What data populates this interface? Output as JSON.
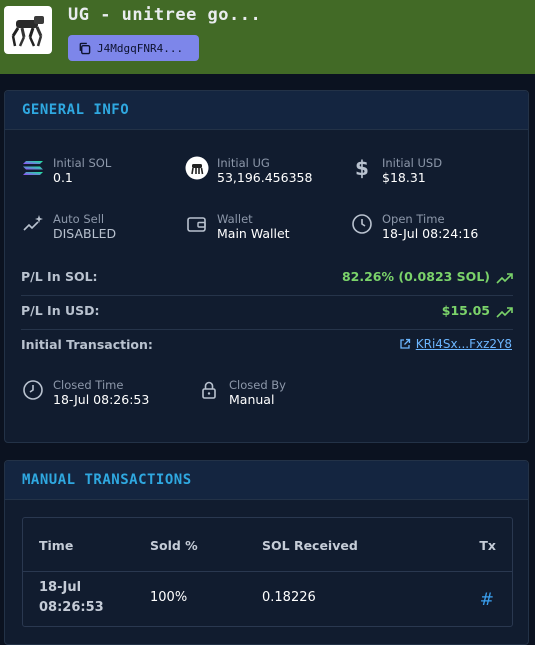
{
  "header": {
    "title": "UG - unitree go...",
    "mint_short": "J4MdgqFNR4..."
  },
  "general": {
    "title": "GENERAL INFO",
    "items": [
      {
        "label": "Initial SOL",
        "value": "0.1"
      },
      {
        "label": "Initial UG",
        "value": "53,196.456358"
      },
      {
        "label": "Initial USD",
        "value": "$18.31"
      },
      {
        "label": "Auto Sell",
        "value": "DISABLED"
      },
      {
        "label": "Wallet",
        "value": "Main Wallet"
      },
      {
        "label": "Open Time",
        "value": "18-Jul 08:24:16"
      }
    ],
    "pl_sol_label": "P/L In SOL:",
    "pl_sol_value": "82.26% (0.0823 SOL)",
    "pl_usd_label": "P/L In USD:",
    "pl_usd_value": "$15.05",
    "init_tx_label": "Initial Transaction:",
    "init_tx_value": "KRi4Sx...Fxz2Y8",
    "closed_time_label": "Closed Time",
    "closed_time_value": "18-Jul 08:26:53",
    "closed_by_label": "Closed By",
    "closed_by_value": "Manual",
    "positive_color": "#7bd36a"
  },
  "manual": {
    "title": "MANUAL TRANSACTIONS",
    "columns": [
      "Time",
      "Sold %",
      "SOL Received",
      "Tx"
    ],
    "rows": [
      {
        "time_date": "18-Jul",
        "time_clock": "08:26:53",
        "sold": "100%",
        "received": "0.18226",
        "tx": "#"
      }
    ]
  },
  "colors": {
    "header_bg": "#426a26",
    "accent": "#2fa8e0",
    "chip": "#7d86ea",
    "link": "#6cb6ff"
  }
}
